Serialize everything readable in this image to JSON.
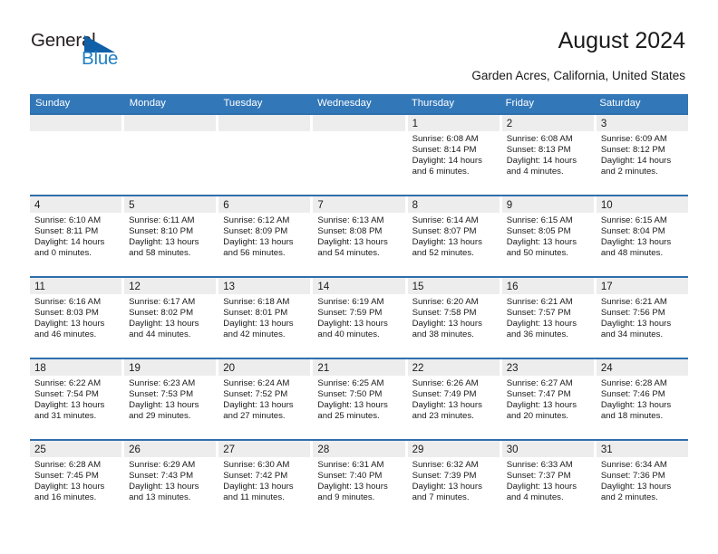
{
  "brand": {
    "name_part1": "General",
    "name_part2": "Blue",
    "triangle_color": "#1060a8",
    "blue_color": "#1f7fc4"
  },
  "header": {
    "title": "August 2024",
    "subtitle": "Garden Acres, California, United States"
  },
  "theme": {
    "header_bg": "#3277b8",
    "row_divider": "#2f6fae",
    "day_band_bg": "#ededed",
    "text": "#1a1a1a"
  },
  "calendar": {
    "weekdays": [
      "Sunday",
      "Monday",
      "Tuesday",
      "Wednesday",
      "Thursday",
      "Friday",
      "Saturday"
    ],
    "weeks": [
      [
        {
          "day": "",
          "sunrise": "",
          "sunset": "",
          "daylight_line1": "",
          "daylight_line2": ""
        },
        {
          "day": "",
          "sunrise": "",
          "sunset": "",
          "daylight_line1": "",
          "daylight_line2": ""
        },
        {
          "day": "",
          "sunrise": "",
          "sunset": "",
          "daylight_line1": "",
          "daylight_line2": ""
        },
        {
          "day": "",
          "sunrise": "",
          "sunset": "",
          "daylight_line1": "",
          "daylight_line2": ""
        },
        {
          "day": "1",
          "sunrise": "Sunrise: 6:08 AM",
          "sunset": "Sunset: 8:14 PM",
          "daylight_line1": "Daylight: 14 hours",
          "daylight_line2": "and 6 minutes."
        },
        {
          "day": "2",
          "sunrise": "Sunrise: 6:08 AM",
          "sunset": "Sunset: 8:13 PM",
          "daylight_line1": "Daylight: 14 hours",
          "daylight_line2": "and 4 minutes."
        },
        {
          "day": "3",
          "sunrise": "Sunrise: 6:09 AM",
          "sunset": "Sunset: 8:12 PM",
          "daylight_line1": "Daylight: 14 hours",
          "daylight_line2": "and 2 minutes."
        }
      ],
      [
        {
          "day": "4",
          "sunrise": "Sunrise: 6:10 AM",
          "sunset": "Sunset: 8:11 PM",
          "daylight_line1": "Daylight: 14 hours",
          "daylight_line2": "and 0 minutes."
        },
        {
          "day": "5",
          "sunrise": "Sunrise: 6:11 AM",
          "sunset": "Sunset: 8:10 PM",
          "daylight_line1": "Daylight: 13 hours",
          "daylight_line2": "and 58 minutes."
        },
        {
          "day": "6",
          "sunrise": "Sunrise: 6:12 AM",
          "sunset": "Sunset: 8:09 PM",
          "daylight_line1": "Daylight: 13 hours",
          "daylight_line2": "and 56 minutes."
        },
        {
          "day": "7",
          "sunrise": "Sunrise: 6:13 AM",
          "sunset": "Sunset: 8:08 PM",
          "daylight_line1": "Daylight: 13 hours",
          "daylight_line2": "and 54 minutes."
        },
        {
          "day": "8",
          "sunrise": "Sunrise: 6:14 AM",
          "sunset": "Sunset: 8:07 PM",
          "daylight_line1": "Daylight: 13 hours",
          "daylight_line2": "and 52 minutes."
        },
        {
          "day": "9",
          "sunrise": "Sunrise: 6:15 AM",
          "sunset": "Sunset: 8:05 PM",
          "daylight_line1": "Daylight: 13 hours",
          "daylight_line2": "and 50 minutes."
        },
        {
          "day": "10",
          "sunrise": "Sunrise: 6:15 AM",
          "sunset": "Sunset: 8:04 PM",
          "daylight_line1": "Daylight: 13 hours",
          "daylight_line2": "and 48 minutes."
        }
      ],
      [
        {
          "day": "11",
          "sunrise": "Sunrise: 6:16 AM",
          "sunset": "Sunset: 8:03 PM",
          "daylight_line1": "Daylight: 13 hours",
          "daylight_line2": "and 46 minutes."
        },
        {
          "day": "12",
          "sunrise": "Sunrise: 6:17 AM",
          "sunset": "Sunset: 8:02 PM",
          "daylight_line1": "Daylight: 13 hours",
          "daylight_line2": "and 44 minutes."
        },
        {
          "day": "13",
          "sunrise": "Sunrise: 6:18 AM",
          "sunset": "Sunset: 8:01 PM",
          "daylight_line1": "Daylight: 13 hours",
          "daylight_line2": "and 42 minutes."
        },
        {
          "day": "14",
          "sunrise": "Sunrise: 6:19 AM",
          "sunset": "Sunset: 7:59 PM",
          "daylight_line1": "Daylight: 13 hours",
          "daylight_line2": "and 40 minutes."
        },
        {
          "day": "15",
          "sunrise": "Sunrise: 6:20 AM",
          "sunset": "Sunset: 7:58 PM",
          "daylight_line1": "Daylight: 13 hours",
          "daylight_line2": "and 38 minutes."
        },
        {
          "day": "16",
          "sunrise": "Sunrise: 6:21 AM",
          "sunset": "Sunset: 7:57 PM",
          "daylight_line1": "Daylight: 13 hours",
          "daylight_line2": "and 36 minutes."
        },
        {
          "day": "17",
          "sunrise": "Sunrise: 6:21 AM",
          "sunset": "Sunset: 7:56 PM",
          "daylight_line1": "Daylight: 13 hours",
          "daylight_line2": "and 34 minutes."
        }
      ],
      [
        {
          "day": "18",
          "sunrise": "Sunrise: 6:22 AM",
          "sunset": "Sunset: 7:54 PM",
          "daylight_line1": "Daylight: 13 hours",
          "daylight_line2": "and 31 minutes."
        },
        {
          "day": "19",
          "sunrise": "Sunrise: 6:23 AM",
          "sunset": "Sunset: 7:53 PM",
          "daylight_line1": "Daylight: 13 hours",
          "daylight_line2": "and 29 minutes."
        },
        {
          "day": "20",
          "sunrise": "Sunrise: 6:24 AM",
          "sunset": "Sunset: 7:52 PM",
          "daylight_line1": "Daylight: 13 hours",
          "daylight_line2": "and 27 minutes."
        },
        {
          "day": "21",
          "sunrise": "Sunrise: 6:25 AM",
          "sunset": "Sunset: 7:50 PM",
          "daylight_line1": "Daylight: 13 hours",
          "daylight_line2": "and 25 minutes."
        },
        {
          "day": "22",
          "sunrise": "Sunrise: 6:26 AM",
          "sunset": "Sunset: 7:49 PM",
          "daylight_line1": "Daylight: 13 hours",
          "daylight_line2": "and 23 minutes."
        },
        {
          "day": "23",
          "sunrise": "Sunrise: 6:27 AM",
          "sunset": "Sunset: 7:47 PM",
          "daylight_line1": "Daylight: 13 hours",
          "daylight_line2": "and 20 minutes."
        },
        {
          "day": "24",
          "sunrise": "Sunrise: 6:28 AM",
          "sunset": "Sunset: 7:46 PM",
          "daylight_line1": "Daylight: 13 hours",
          "daylight_line2": "and 18 minutes."
        }
      ],
      [
        {
          "day": "25",
          "sunrise": "Sunrise: 6:28 AM",
          "sunset": "Sunset: 7:45 PM",
          "daylight_line1": "Daylight: 13 hours",
          "daylight_line2": "and 16 minutes."
        },
        {
          "day": "26",
          "sunrise": "Sunrise: 6:29 AM",
          "sunset": "Sunset: 7:43 PM",
          "daylight_line1": "Daylight: 13 hours",
          "daylight_line2": "and 13 minutes."
        },
        {
          "day": "27",
          "sunrise": "Sunrise: 6:30 AM",
          "sunset": "Sunset: 7:42 PM",
          "daylight_line1": "Daylight: 13 hours",
          "daylight_line2": "and 11 minutes."
        },
        {
          "day": "28",
          "sunrise": "Sunrise: 6:31 AM",
          "sunset": "Sunset: 7:40 PM",
          "daylight_line1": "Daylight: 13 hours",
          "daylight_line2": "and 9 minutes."
        },
        {
          "day": "29",
          "sunrise": "Sunrise: 6:32 AM",
          "sunset": "Sunset: 7:39 PM",
          "daylight_line1": "Daylight: 13 hours",
          "daylight_line2": "and 7 minutes."
        },
        {
          "day": "30",
          "sunrise": "Sunrise: 6:33 AM",
          "sunset": "Sunset: 7:37 PM",
          "daylight_line1": "Daylight: 13 hours",
          "daylight_line2": "and 4 minutes."
        },
        {
          "day": "31",
          "sunrise": "Sunrise: 6:34 AM",
          "sunset": "Sunset: 7:36 PM",
          "daylight_line1": "Daylight: 13 hours",
          "daylight_line2": "and 2 minutes."
        }
      ]
    ]
  }
}
